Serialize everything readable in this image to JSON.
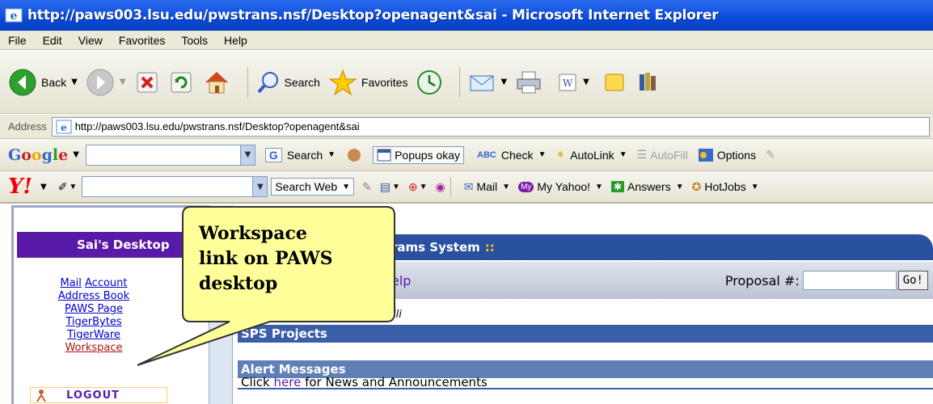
{
  "window": {
    "title": "http://paws003.lsu.edu/pwstrans.nsf/Desktop?openagent&sai - Microsoft Internet Explorer"
  },
  "menu": [
    "File",
    "Edit",
    "View",
    "Favorites",
    "Tools",
    "Help"
  ],
  "toolbar": {
    "back_label": "Back",
    "search_label": "Search",
    "favorites_label": "Favorites"
  },
  "address": {
    "label": "Address",
    "url": "http://paws003.lsu.edu/pwstrans.nsf/Desktop?openagent&sai"
  },
  "google_toolbar": {
    "logo": "Google",
    "search_label": "Search",
    "popups_label": "Popups okay",
    "check_label": "Check",
    "autolink_label": "AutoLink",
    "autofill_label": "AutoFill",
    "options_label": "Options"
  },
  "yahoo_toolbar": {
    "logo": "Y!",
    "search_web_label": "Search Web",
    "mail_label": "Mail",
    "my_yahoo_label": "My Yahoo!",
    "answers_label": "Answers",
    "hotjobs_label": "HotJobs"
  },
  "desktop": {
    "header": "Sai's Desktop",
    "links": {
      "mail": "Mail",
      "account": "Account",
      "address_book": "Address Book",
      "paws_page": "PAWS Page",
      "tigerbytes": "TigerBytes",
      "tigerware": "TigerWare",
      "workspace": "Workspace"
    },
    "logout_label": "LOGOUT"
  },
  "main": {
    "banner_fragment": "rams System",
    "banner_colons": "::",
    "help_fragment": "elp",
    "proposal_label": "Proposal #:",
    "go_label": "Go!",
    "user_fragment": "alli",
    "sps_projects": "SPS Projects",
    "alert_messages": "Alert Messages",
    "alert_prefix": "Click ",
    "alert_link": "here",
    "alert_suffix": " for News and Announcements"
  },
  "callout": {
    "line1": "Workspace",
    "line2": "link on PAWS",
    "line3": "desktop"
  },
  "colors": {
    "title_bar": "#0a4ad8",
    "desktop_header": "#5a1aa8",
    "banner": "#2a50a0",
    "callout_fill": "#ffff99"
  }
}
